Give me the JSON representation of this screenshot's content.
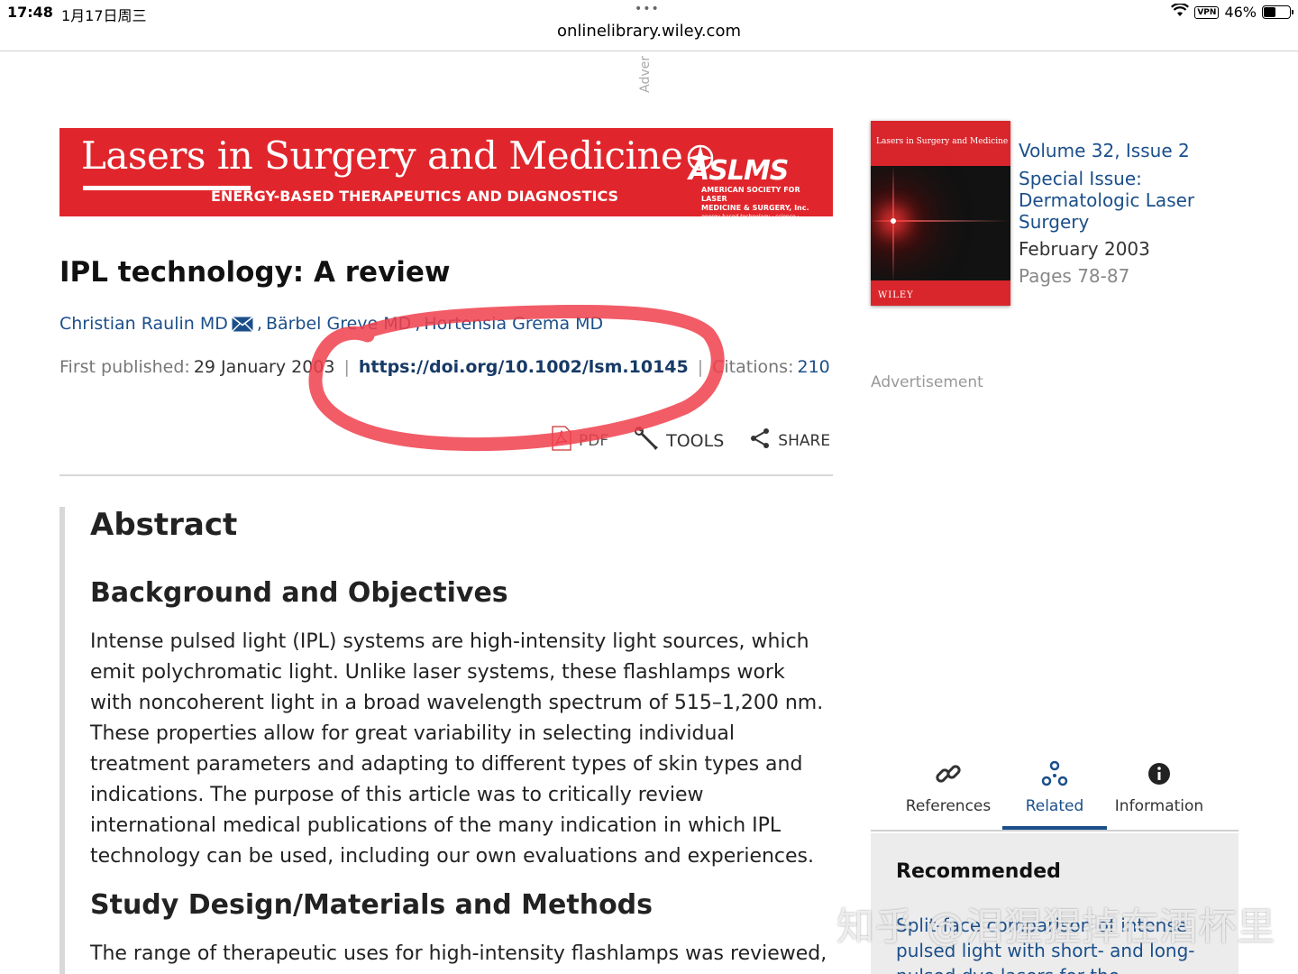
{
  "status": {
    "time": "17:48",
    "date": "1月17日周三",
    "dots": "•••",
    "vpn": "VPN",
    "battery_text": "46%",
    "battery_level": 0.46
  },
  "browser": {
    "url": "onlinelibrary.wiley.com"
  },
  "ad_vertical": "Adver",
  "banner": {
    "title": "Lasers in Surgery and Medicine",
    "subtitle": "ENERGY-BASED THERAPEUTICS AND DIAGNOSTICS",
    "logo": "ASLMS",
    "logo_sub_1": "AMERICAN SOCIETY FOR LASER",
    "logo_sub_2": "MEDICINE & SURGERY, Inc.",
    "logo_sub_3": "energy-based technology · science · medicine"
  },
  "article": {
    "title": "IPL technology: A review",
    "authors": [
      "Christian Raulin MD",
      "Bärbel Greve MD",
      "Hortensia Grema MD"
    ],
    "first_published_label": "First published:",
    "first_published_value": "29 January 2003",
    "doi": "https://doi.org/10.1002/lsm.10145",
    "citations_label": "Citations:",
    "citations_value": "210"
  },
  "toolbar": {
    "pdf": "PDF",
    "tools": "TOOLS",
    "share": "SHARE"
  },
  "abstract": {
    "heading": "Abstract",
    "sections": [
      {
        "heading": "Background and Objectives",
        "text": "Intense pulsed light (IPL) systems are high-intensity light sources, which emit polychromatic light. Unlike laser systems, these flashlamps work with noncoherent light in a broad wavelength spectrum of 515–1,200 nm. These properties allow for great variability in selecting individual treatment parameters and adapting to different types of skin types and indications. The purpose of this article was to critically review international medical publications of the many indication in which IPL technology can be used, including our own evaluations and experiences."
      },
      {
        "heading": "Study Design/Materials and Methods",
        "text": "The range of therapeutic uses for high-intensity flashlamps was reviewed,"
      }
    ]
  },
  "sidebar": {
    "cover_title": "Lasers in Surgery and Medicine",
    "cover_publisher": "WILEY",
    "volume": "Volume 32, Issue 2",
    "special_issue": "Special Issue: Dermatologic Laser Surgery",
    "date": "February 2003",
    "pages": "Pages 78-87",
    "advertisement": "Advertisement",
    "tabs": [
      {
        "label": "References",
        "icon": "link-icon"
      },
      {
        "label": "Related",
        "icon": "related-icon"
      },
      {
        "label": "Information",
        "icon": "info-icon"
      }
    ],
    "recommended_heading": "Recommended",
    "recommended_link": "Split-face comparison of intense pulsed light with short- and long-pulsed dye lasers for the treatment"
  },
  "watermark": "知乎 @泪猩猩掉在酒杯里",
  "colors": {
    "link": "#1b4f8a",
    "banner": "#e0262c",
    "annotation": "#f0404c"
  }
}
